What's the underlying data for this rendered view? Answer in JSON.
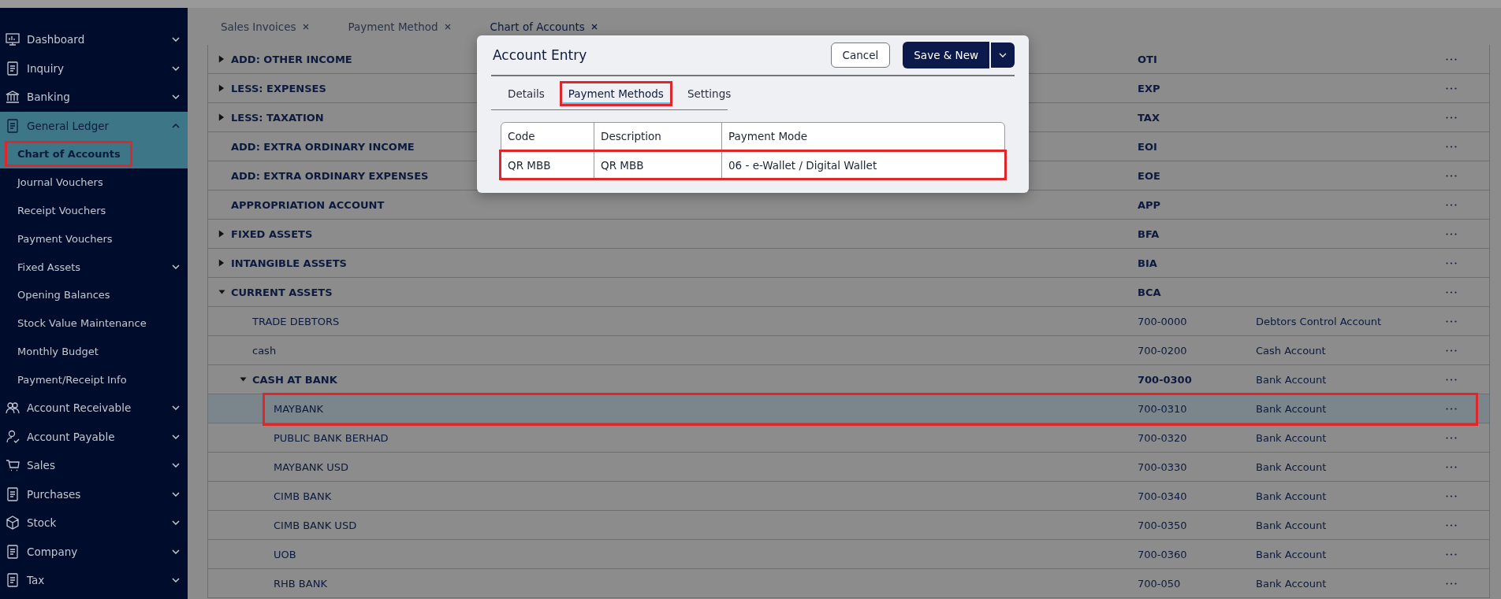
{
  "sidebar": {
    "menu": [
      {
        "label": "Dashboard",
        "expanded": false
      },
      {
        "label": "Inquiry",
        "expanded": false
      },
      {
        "label": "Banking",
        "expanded": false
      },
      {
        "label": "General Ledger",
        "expanded": true,
        "children": [
          {
            "label": "Chart of Accounts",
            "selected": true,
            "outlined": true,
            "expandable": false
          },
          {
            "label": "Journal Vouchers",
            "selected": false,
            "outlined": false,
            "expandable": false
          },
          {
            "label": "Receipt Vouchers",
            "selected": false,
            "outlined": false,
            "expandable": false
          },
          {
            "label": "Payment Vouchers",
            "selected": false,
            "outlined": false,
            "expandable": false
          },
          {
            "label": "Fixed Assets",
            "selected": false,
            "outlined": false,
            "expandable": true
          },
          {
            "label": "Opening Balances",
            "selected": false,
            "outlined": false,
            "expandable": false
          },
          {
            "label": "Stock Value Maintenance",
            "selected": false,
            "outlined": false,
            "expandable": false
          },
          {
            "label": "Monthly Budget",
            "selected": false,
            "outlined": false,
            "expandable": false
          },
          {
            "label": "Payment/Receipt Info",
            "selected": false,
            "outlined": false,
            "expandable": false
          }
        ]
      },
      {
        "label": "Account Receivable",
        "expanded": false
      },
      {
        "label": "Account Payable",
        "expanded": false
      },
      {
        "label": "Sales",
        "expanded": false
      },
      {
        "label": "Purchases",
        "expanded": false
      },
      {
        "label": "Stock",
        "expanded": false
      },
      {
        "label": "Company",
        "expanded": false
      },
      {
        "label": "Tax",
        "expanded": false
      }
    ]
  },
  "tabs": [
    {
      "label": "Sales Invoices",
      "selected": false
    },
    {
      "label": "Payment Method",
      "selected": false
    },
    {
      "label": "Chart of Accounts",
      "selected": true
    }
  ],
  "accounts": [
    {
      "name": "ADD: OTHER INCOME",
      "code": "OTI",
      "kind": "group",
      "has_children": true,
      "expanded": false,
      "selected": false,
      "outlined": false
    },
    {
      "name": "LESS: EXPENSES",
      "code": "EXP",
      "kind": "group",
      "has_children": true,
      "expanded": false,
      "selected": false,
      "outlined": false
    },
    {
      "name": "LESS: TAXATION",
      "code": "TAX",
      "kind": "group",
      "has_children": true,
      "expanded": false,
      "selected": false,
      "outlined": false
    },
    {
      "name": "ADD: EXTRA ORDINARY INCOME",
      "code": "EOI",
      "kind": "group",
      "has_children": false,
      "selected": false,
      "outlined": false
    },
    {
      "name": "ADD: EXTRA ORDINARY EXPENSES",
      "code": "EOE",
      "kind": "group",
      "has_children": false,
      "selected": false,
      "outlined": false
    },
    {
      "name": "APPROPRIATION ACCOUNT",
      "code": "APP",
      "kind": "group",
      "has_children": false,
      "selected": false,
      "outlined": false
    },
    {
      "name": "FIXED ASSETS",
      "code": "BFA",
      "kind": "group",
      "has_children": true,
      "expanded": false,
      "selected": false,
      "outlined": false
    },
    {
      "name": "INTANGIBLE ASSETS",
      "code": "BIA",
      "kind": "group",
      "has_children": true,
      "expanded": false,
      "selected": false,
      "outlined": false
    },
    {
      "name": "CURRENT ASSETS",
      "code": "BCA",
      "kind": "group",
      "has_children": true,
      "expanded": true,
      "selected": false,
      "outlined": false,
      "children": [
        {
          "name": "TRADE DEBTORS",
          "code": "700-0000",
          "description": "Debtors Control Account",
          "kind": "account",
          "has_children": false,
          "selected": false,
          "outlined": false
        },
        {
          "name": "cash",
          "code": "700-0200",
          "description": "Cash Account",
          "kind": "account",
          "has_children": false,
          "selected": false,
          "outlined": false
        },
        {
          "name": "CASH AT BANK",
          "code": "700-0300",
          "description": "Bank Account",
          "kind": "group",
          "has_children": true,
          "expanded": true,
          "selected": false,
          "outlined": false,
          "children": [
            {
              "name": "MAYBANK",
              "code": "700-0310",
              "description": "Bank Account",
              "kind": "account",
              "has_children": false,
              "selected": true,
              "outlined": true
            },
            {
              "name": "PUBLIC BANK BERHAD",
              "code": "700-0320",
              "description": "Bank Account",
              "kind": "account",
              "has_children": false,
              "selected": false,
              "outlined": false
            },
            {
              "name": "MAYBANK USD",
              "code": "700-0330",
              "description": "Bank Account",
              "kind": "account",
              "has_children": false,
              "selected": false,
              "outlined": false
            },
            {
              "name": "CIMB BANK",
              "code": "700-0340",
              "description": "Bank Account",
              "kind": "account",
              "has_children": false,
              "selected": false,
              "outlined": false
            },
            {
              "name": "CIMB BANK USD",
              "code": "700-0350",
              "description": "Bank Account",
              "kind": "account",
              "has_children": false,
              "selected": false,
              "outlined": false
            },
            {
              "name": "UOB",
              "code": "700-0360",
              "description": "Bank Account",
              "kind": "account",
              "has_children": false,
              "selected": false,
              "outlined": false
            },
            {
              "name": "RHB BANK",
              "code": "700-050",
              "description": "Bank Account",
              "kind": "account",
              "has_children": false,
              "selected": false,
              "outlined": false
            }
          ]
        }
      ]
    }
  ],
  "modal": {
    "title": "Account Entry",
    "cancel": "Cancel",
    "save": "Save & New",
    "tabs": [
      {
        "label": "Details",
        "selected": false,
        "outlined": false
      },
      {
        "label": "Payment Methods",
        "selected": true,
        "outlined": true
      },
      {
        "label": "Settings",
        "selected": false,
        "outlined": false
      }
    ],
    "table": {
      "columns": [
        "Code",
        "Description",
        "Payment Mode"
      ],
      "rows": [
        {
          "cells": [
            "QR MBB",
            "QR MBB",
            "06 - e-Wallet / Digital Wallet"
          ],
          "outlined": true
        }
      ]
    }
  }
}
